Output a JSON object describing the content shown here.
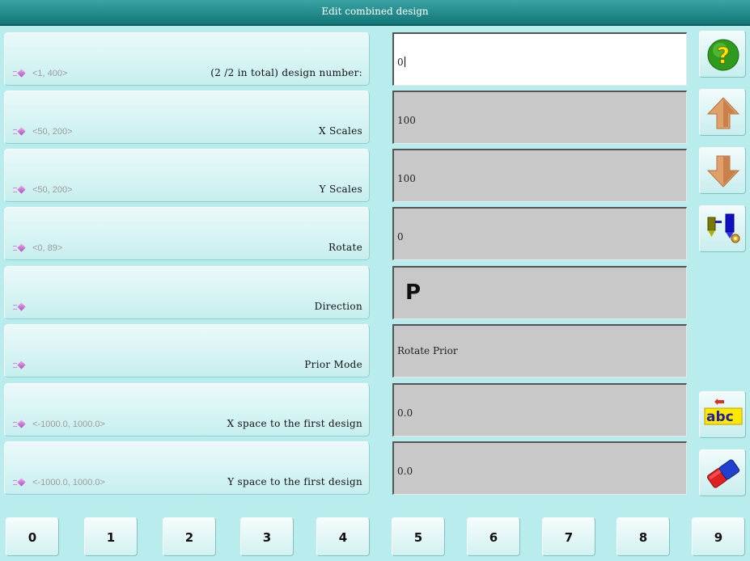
{
  "window": {
    "title": "Edit combined design"
  },
  "rows": [
    {
      "range": "<1, 400>",
      "label": "(2 /2 in total) design number:",
      "value": "0"
    },
    {
      "range": "<50, 200>",
      "label": "X Scales",
      "value": "100"
    },
    {
      "range": "<50, 200>",
      "label": "Y Scales",
      "value": "100"
    },
    {
      "range": "<0, 89>",
      "label": "Rotate",
      "value": "0"
    },
    {
      "range": "",
      "label": "Direction",
      "value": "P"
    },
    {
      "range": "",
      "label": "Prior Mode",
      "value": "Rotate Prior"
    },
    {
      "range": "<-1000.0, 1000.0>",
      "label": "X space to the first design",
      "value": "0.0"
    },
    {
      "range": "<-1000.0, 1000.0>",
      "label": "Y space to the first design",
      "value": "0.0"
    }
  ],
  "side_buttons": [
    "help-icon",
    "arrow-up-icon",
    "arrow-down-icon",
    "combine-design-icon",
    "abc-input-icon",
    "eraser-icon"
  ],
  "keypad": [
    "0",
    "1",
    "2",
    "3",
    "4",
    "5",
    "6",
    "7",
    "8",
    "9"
  ],
  "colors": {
    "background": "#b9ecec",
    "title_bar": "#1a7c7c",
    "value_field": "#c8c8c8",
    "active_field": "#ffffff"
  }
}
